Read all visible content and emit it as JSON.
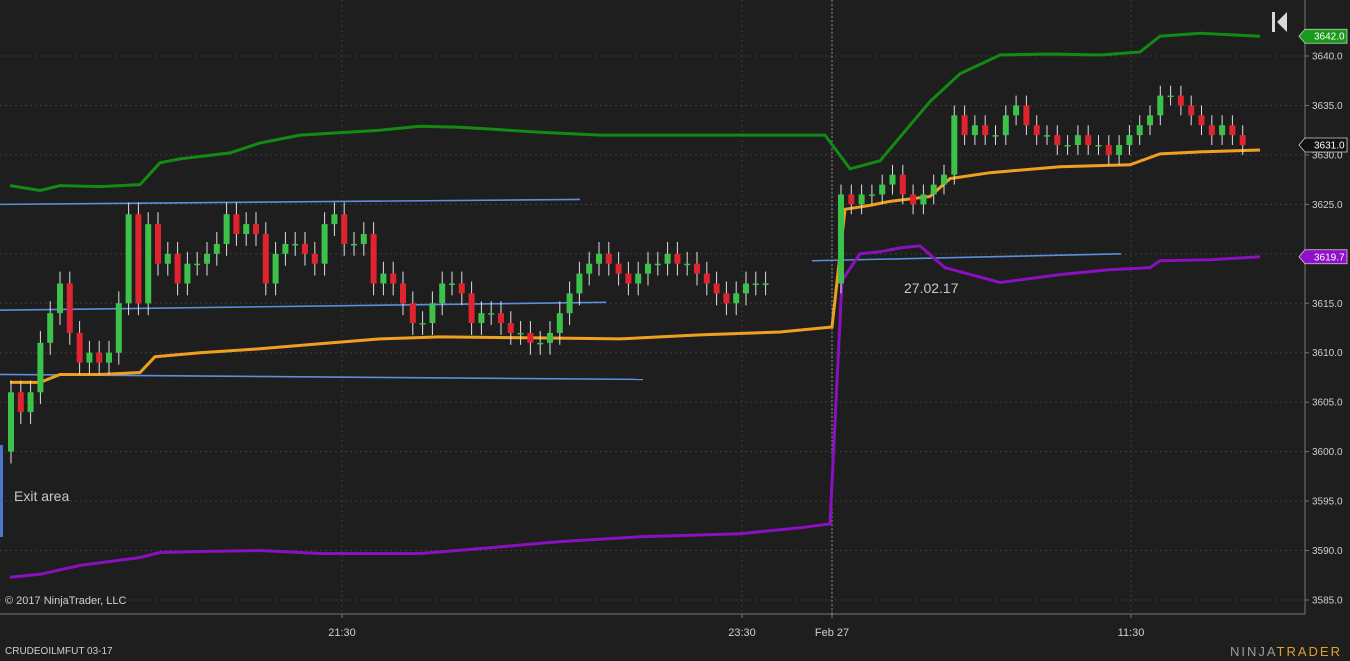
{
  "chart_data": {
    "type": "candlestick",
    "instrument": "CRUDEOILMFUT 03-17",
    "ylim": [
      3583,
      3646
    ],
    "y_ticks": [
      "3585.0",
      "3590.0",
      "3595.0",
      "3600.0",
      "3605.0",
      "3610.0",
      "3615.0",
      "3620.0",
      "3625.0",
      "3630.0",
      "3635.0",
      "3640.0"
    ],
    "x_ticks": [
      "21:30",
      "23:30",
      "Feb 27",
      "11:30"
    ],
    "session_break_label": "Feb 27",
    "price_badges": [
      {
        "value": "3642.0",
        "color": "#1a9a1a",
        "text_color": "#ffffff"
      },
      {
        "value": "3631.0",
        "color": "#111111",
        "text_color": "#ffffff"
      },
      {
        "value": "3619.7",
        "color": "#8f10c8",
        "text_color": "#ffffff"
      }
    ],
    "colors": {
      "up": "#3cc24a",
      "down": "#e0242f",
      "upper_band": "#138a13",
      "lower_band": "#8a10c0",
      "mid_line": "#f0a020",
      "trendline": "#5b8fdc",
      "grid": "#3c3c3c"
    },
    "annotations": [
      {
        "text": "Exit area"
      },
      {
        "text": "27.02.17"
      }
    ],
    "candles_sample": [
      {
        "o": 3600,
        "h": 3606,
        "l": 3600,
        "c": 3606
      },
      {
        "o": 3624,
        "h": 3626,
        "l": 3608,
        "c": 3608
      },
      {
        "o": 3612,
        "h": 3618,
        "l": 3608,
        "c": 3618
      },
      {
        "o": 3619,
        "h": 3620,
        "l": 3614,
        "c": 3619
      },
      {
        "o": 3634,
        "h": 3635,
        "l": 3632,
        "c": 3632
      },
      {
        "o": 3632,
        "h": 3636,
        "l": 3630,
        "c": 3635
      }
    ]
  },
  "footer": {
    "copyright": "© 2017 NinjaTrader, LLC",
    "symbol": "CRUDEOILMFUT 03-17",
    "brand_a": "NINJA",
    "brand_b": "TRADER"
  }
}
